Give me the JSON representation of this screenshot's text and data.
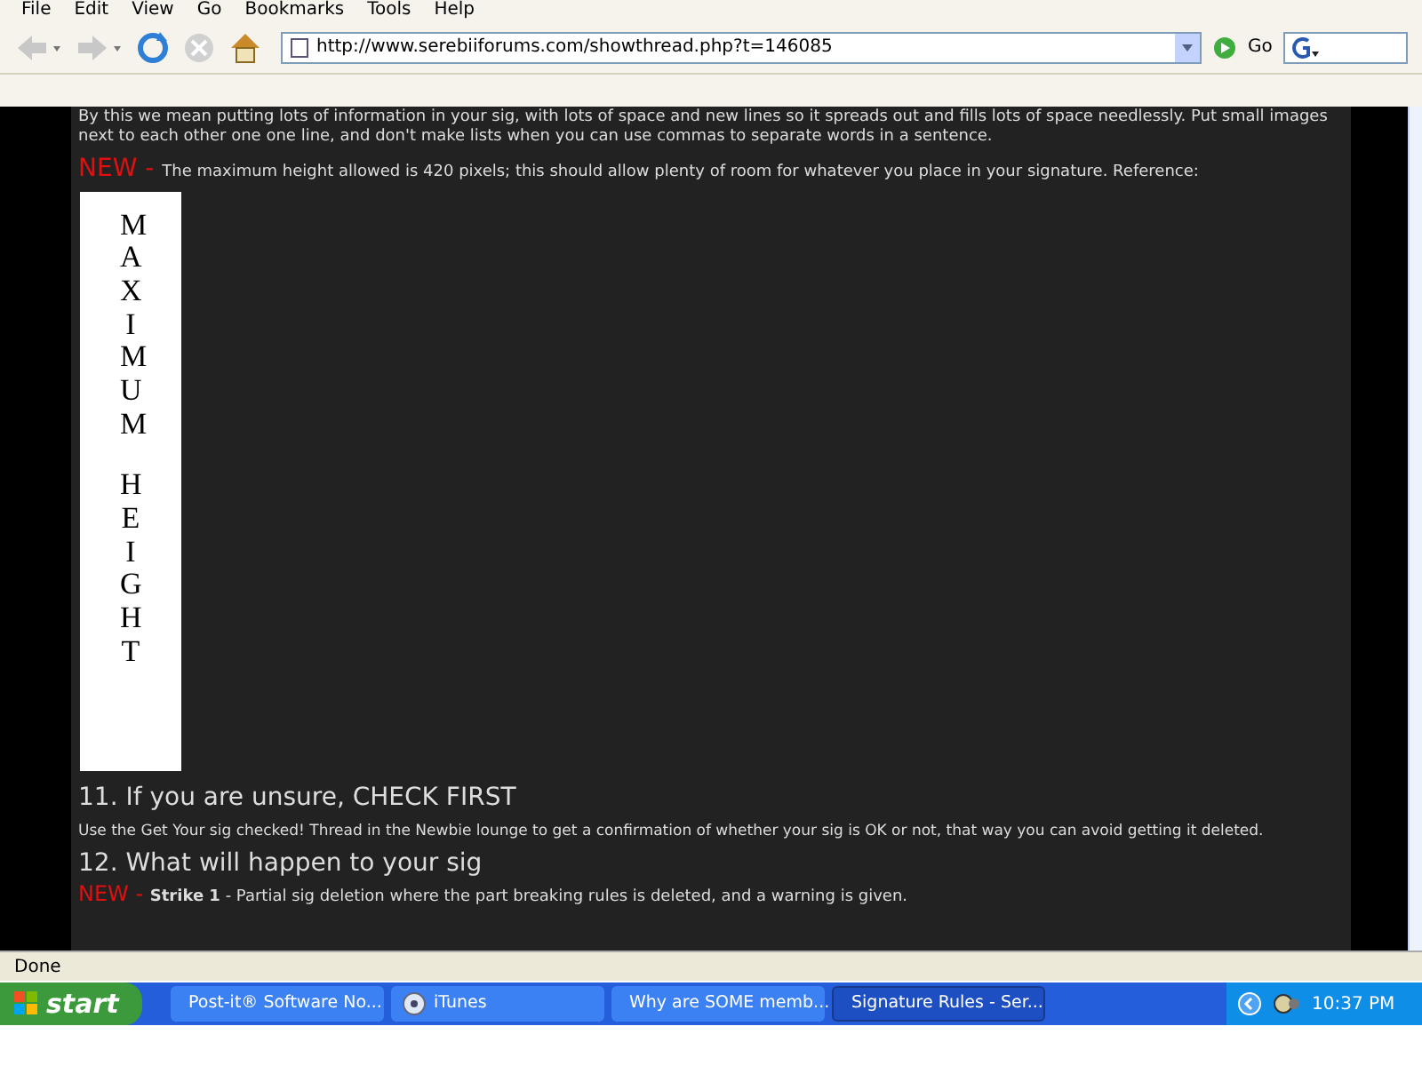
{
  "menu": [
    "File",
    "Edit",
    "View",
    "Go",
    "Bookmarks",
    "Tools",
    "Help"
  ],
  "address": {
    "value": "http://www.serebiiforums.com/showthread.php?t=146085",
    "go": "Go"
  },
  "content": {
    "intro": "By this we mean putting lots of information in your sig, with lots of space and new lines so it spreads out and fills lots of space needlessly. Put small images next to each other one one line, and don't make lists when you can use commas to separate words in a sentence.",
    "new_note": {
      "badge": "NEW - ",
      "text": "The maximum height allowed is 420 pixels; this should allow plenty of room for whatever you place in your signature. Reference:"
    },
    "reference_words": [
      "MAXIMUM",
      "HEIGHT"
    ],
    "section_11": {
      "heading": "11. If you are unsure, CHECK FIRST",
      "text": "Use the Get Your sig checked! Thread in the Newbie lounge to get a confirmation of whether your sig is OK or not, that way you can avoid getting it deleted."
    },
    "section_12": {
      "heading": "12. What will happen to your sig",
      "badge": "NEW - ",
      "text": "**Strike 1** - Partial sig deletion where the part breaking rules is deleted, and a warning is given."
    }
  },
  "status_bar": "Done",
  "taskbar": {
    "start": "start",
    "tasks": [
      {
        "label": "Post-it® Software No...",
        "kind": "note",
        "selected": false
      },
      {
        "label": "iTunes",
        "kind": "music",
        "selected": false
      },
      {
        "label": "Why are SOME memb...",
        "kind": "browser",
        "selected": false
      },
      {
        "label": "Signature Rules - Ser...",
        "kind": "browser",
        "selected": true
      }
    ],
    "clock": "10:37 PM"
  }
}
